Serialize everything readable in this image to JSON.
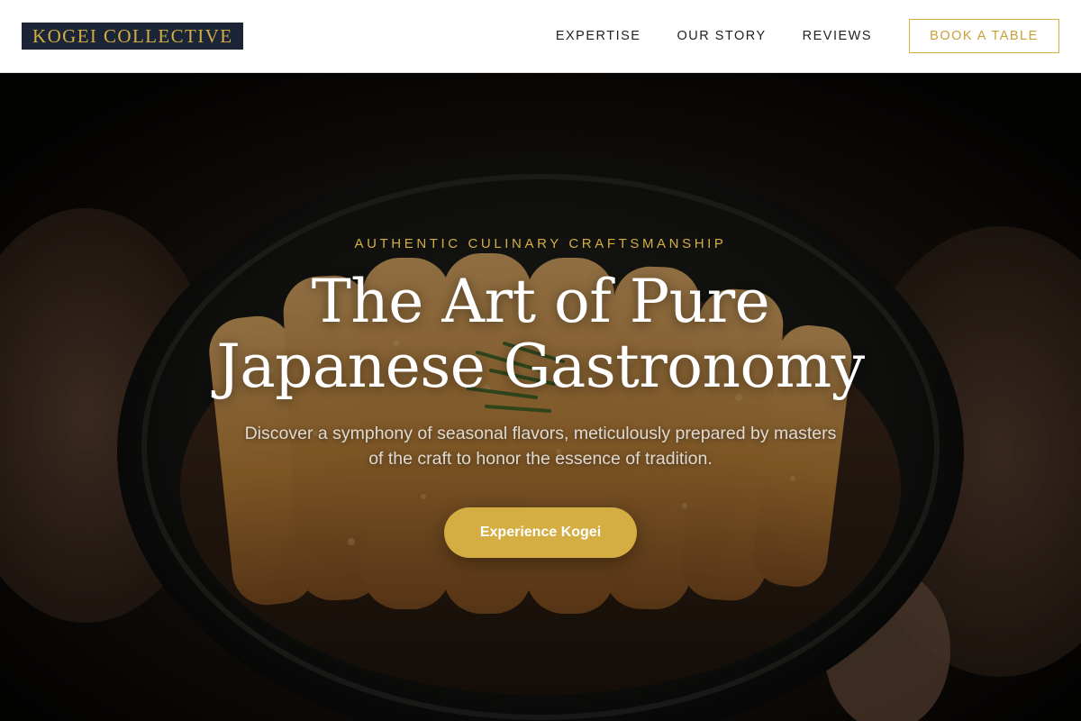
{
  "brand": {
    "name": "KOGEI COLLECTIVE"
  },
  "nav": {
    "links": [
      "EXPERTISE",
      "OUR STORY",
      "REVIEWS"
    ],
    "book_label": "BOOK A TABLE"
  },
  "hero": {
    "eyebrow": "AUTHENTIC CULINARY CRAFTSMANSHIP",
    "title_line1": "The Art of Pure",
    "title_line2": "Japanese Gastronomy",
    "subtitle": "Discover a symphony of seasonal flavors, meticulously prepared by masters of the craft to honor the essence of tradition.",
    "cta_label": "Experience Kogei"
  },
  "colors": {
    "accent_gold": "#d4ad43",
    "logo_bg": "#1c2538",
    "nav_text": "#222222",
    "hero_text": "#ffffff"
  }
}
